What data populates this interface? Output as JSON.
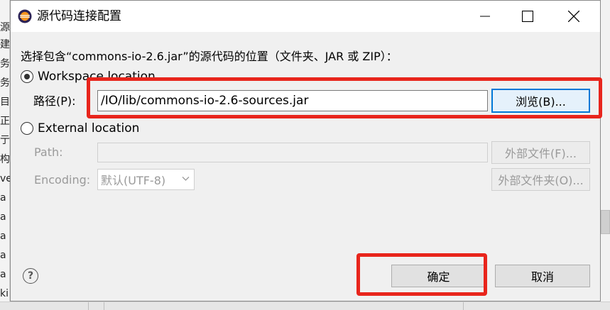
{
  "background": {
    "left_strip_chars": [
      "",
      "源",
      "建",
      "务",
      "务",
      "目",
      "正",
      "亍",
      "构",
      "ve",
      "a",
      "a",
      "a",
      "a",
      "a",
      "ki"
    ]
  },
  "dialog": {
    "title": "源代码连接配置",
    "app_icon": "eclipse-icon",
    "controls": {
      "minimize": "minimize-icon",
      "maximize": "maximize-icon",
      "close": "close-icon"
    },
    "instruction": "选择包含“commons-io-2.6.jar”的源代码的位置（文件夹、JAR 或 ZIP）：",
    "workspace": {
      "radio_label": "Workspace location",
      "selected": true,
      "path_label": "路径(P):",
      "path_value": "/IO/lib/commons-io-2.6-sources.jar",
      "browse_label": "浏览(B)..."
    },
    "external": {
      "radio_label": "External location",
      "selected": false,
      "path_label": "Path:",
      "path_value": "",
      "encoding_label": "Encoding:",
      "encoding_value": "默认(UTF-8)",
      "external_file_label": "外部文件(F)...",
      "external_folder_label": "外部文件夹(O)..."
    },
    "help_icon": "help-icon",
    "ok_label": "确定",
    "cancel_label": "取消"
  },
  "annotation_color": "#e8251c"
}
